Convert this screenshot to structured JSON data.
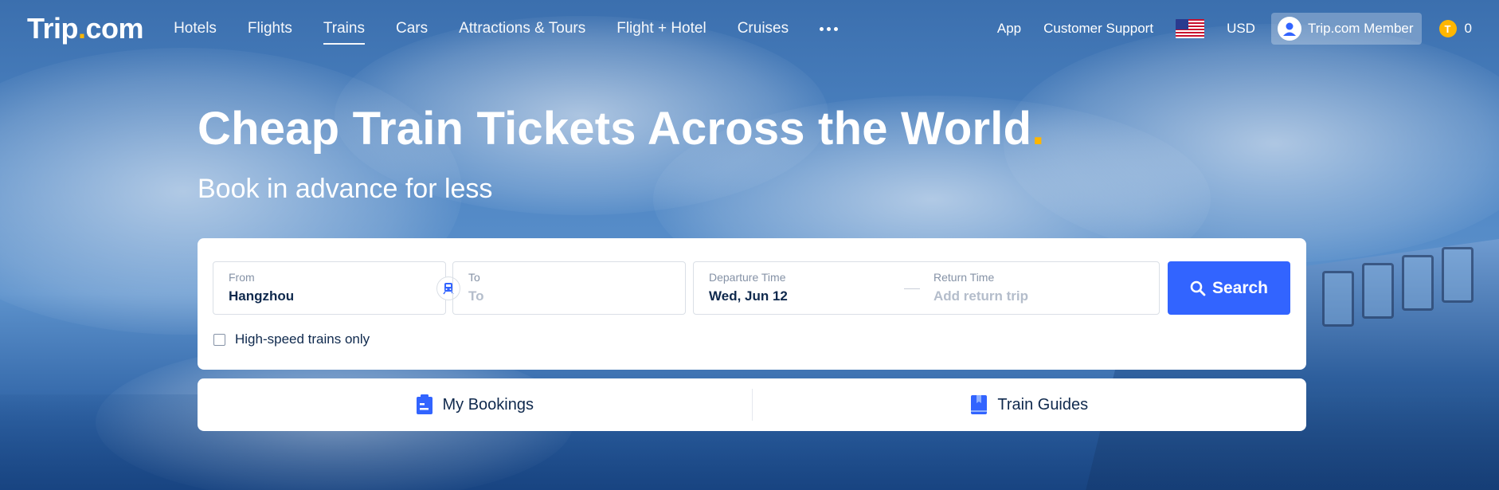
{
  "header": {
    "logo_main": "Trip",
    "logo_dot": ".",
    "logo_suffix": "com",
    "nav": [
      {
        "label": "Hotels"
      },
      {
        "label": "Flights"
      },
      {
        "label": "Trains",
        "active": true
      },
      {
        "label": "Cars"
      },
      {
        "label": "Attractions & Tours"
      },
      {
        "label": "Flight + Hotel"
      },
      {
        "label": "Cruises"
      }
    ],
    "more_icon": "more-dots-icon",
    "app_label": "App",
    "support_label": "Customer Support",
    "flag_icon": "us-flag-icon",
    "currency": "USD",
    "member_label": "Trip.com Member",
    "coin_letter": "T",
    "coin_count": "0"
  },
  "hero": {
    "title": "Cheap Train Tickets Across the World",
    "title_dot": ".",
    "subtitle": "Book in advance for less"
  },
  "search": {
    "from_label": "From",
    "from_value": "Hangzhou",
    "to_label": "To",
    "to_placeholder": "To",
    "departure_label": "Departure Time",
    "departure_value": "Wed, Jun 12",
    "return_label": "Return Time",
    "return_placeholder": "Add return trip",
    "search_button": "Search",
    "high_speed_label": "High-speed trains only"
  },
  "bottom_bar": {
    "bookings_label": "My Bookings",
    "guides_label": "Train Guides"
  },
  "colors": {
    "accent": "#3264ff",
    "brand_dot": "#ffb600",
    "text_dark": "#0f294d"
  }
}
